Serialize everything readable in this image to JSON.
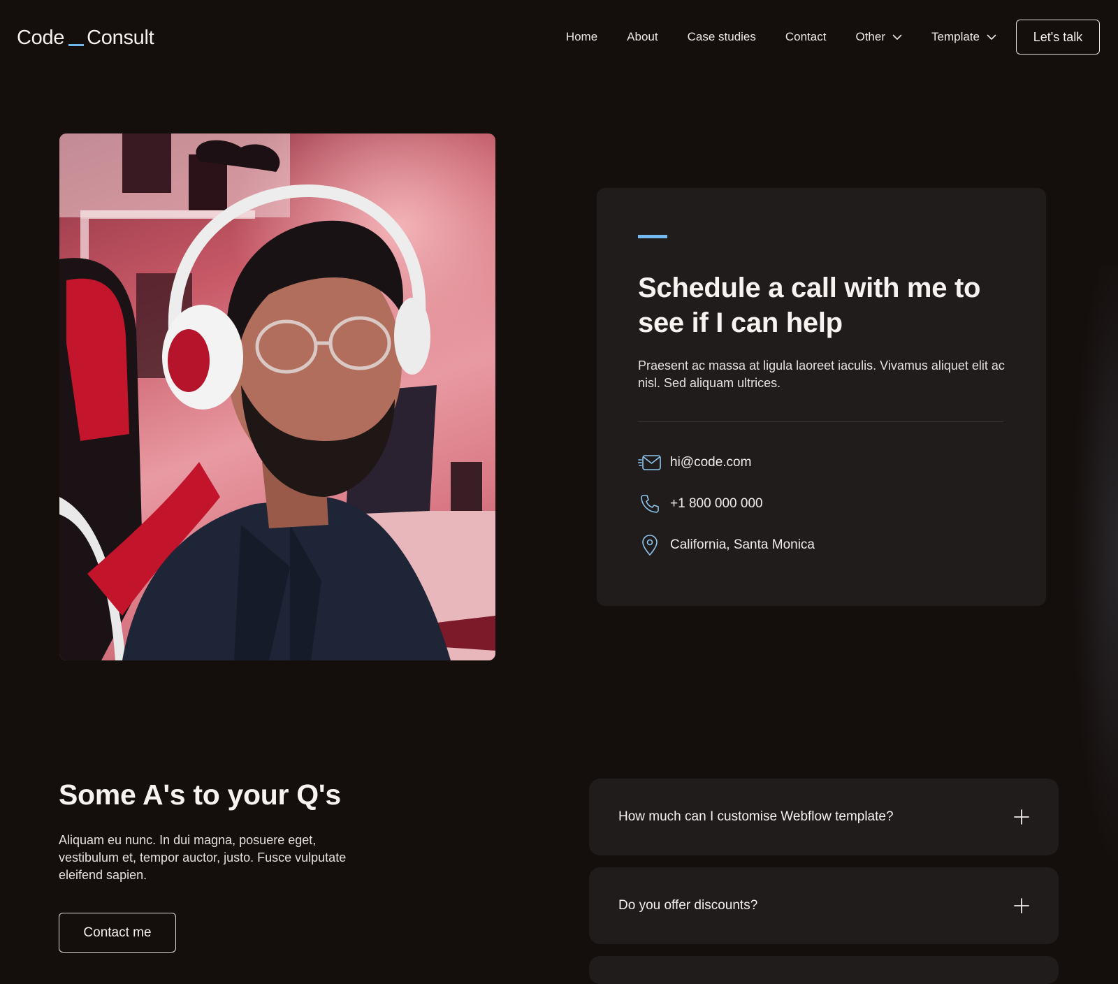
{
  "header": {
    "logo_left": "Code",
    "logo_right": "Consult",
    "nav": {
      "home": "Home",
      "about": "About",
      "case_studies": "Case studies",
      "contact": "Contact",
      "other": "Other",
      "template": "Template"
    },
    "cta_label": "Let's talk"
  },
  "hero": {
    "photo_icon": "portrait-photo",
    "card": {
      "title": "Schedule a call with me to see if I can help",
      "text": "Praesent ac massa at ligula laoreet iaculis. Vivamus aliquet elit ac nisl. Sed aliquam ultrices.",
      "email": "hi@code.com",
      "phone": "+1 800 000 000",
      "location": "California, Santa Monica"
    }
  },
  "faq": {
    "title": "Some A's to your Q's",
    "text": "Aliquam eu nunc. In dui magna, posuere eget, vestibulum et, tempor auctor, justo. Fusce vulputate eleifend sapien.",
    "contact_button": "Contact me",
    "questions": [
      "How much can I customise Webflow template?",
      "Do you offer discounts?"
    ]
  },
  "colors": {
    "background": "#140e0c",
    "card": "#1f1c1b",
    "accent": "#73b9ef",
    "text": "#f6f3f1"
  },
  "icons": [
    "chevron-down-icon",
    "mail-icon",
    "phone-icon",
    "location-pin-icon",
    "plus-icon"
  ]
}
